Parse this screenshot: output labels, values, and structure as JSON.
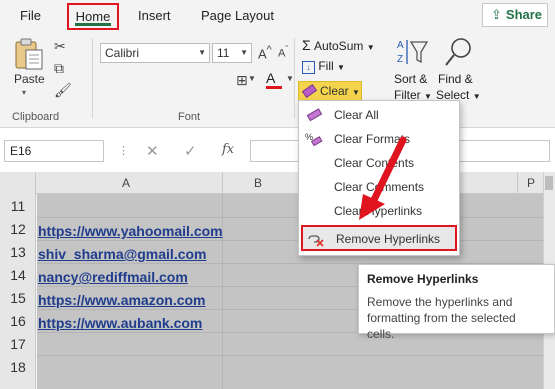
{
  "tabs": {
    "file": "File",
    "home": "Home",
    "insert": "Insert",
    "page_layout": "Page Layout",
    "share": "Share"
  },
  "clipboard": {
    "paste": "Paste",
    "group_label": "Clipboard"
  },
  "font": {
    "name": "Calibri",
    "size": "11",
    "group_label": "Font"
  },
  "editing": {
    "autosum": "AutoSum",
    "fill": "Fill",
    "clear": "Clear",
    "sort_filter_line1": "Sort &",
    "sort_filter_line2": "Filter",
    "find_select_line1": "Find &",
    "find_select_line2": "Select"
  },
  "formula_bar": {
    "name_box": "E16",
    "fx": "fx"
  },
  "columns": [
    "A",
    "B",
    "P"
  ],
  "rows": [
    "11",
    "12",
    "13",
    "14",
    "15",
    "16",
    "17",
    "18"
  ],
  "cells": [
    "https://www.yahoomail.com",
    "shiv_sharma@gmail.com",
    "nancy@rediffmail.com",
    "https://www.amazon.com",
    "https://www.aubank.com"
  ],
  "clear_menu": {
    "clear_all": "Clear All",
    "clear_formats": "Clear Formats",
    "clear_contents": "Clear Contents",
    "clear_comments": "Clear Comments",
    "clear_hyperlinks": "Clear Hyperlinks",
    "remove_hyperlinks": "Remove Hyperlinks"
  },
  "tooltip": {
    "title": "Remove Hyperlinks",
    "body": "Remove the hyperlinks and formatting from the selected cells."
  },
  "colors": {
    "excel_green": "#217346",
    "highlight_red": "#e0141e",
    "clear_yellow": "#f4d44d",
    "link_blue": "#1f3d8c"
  }
}
